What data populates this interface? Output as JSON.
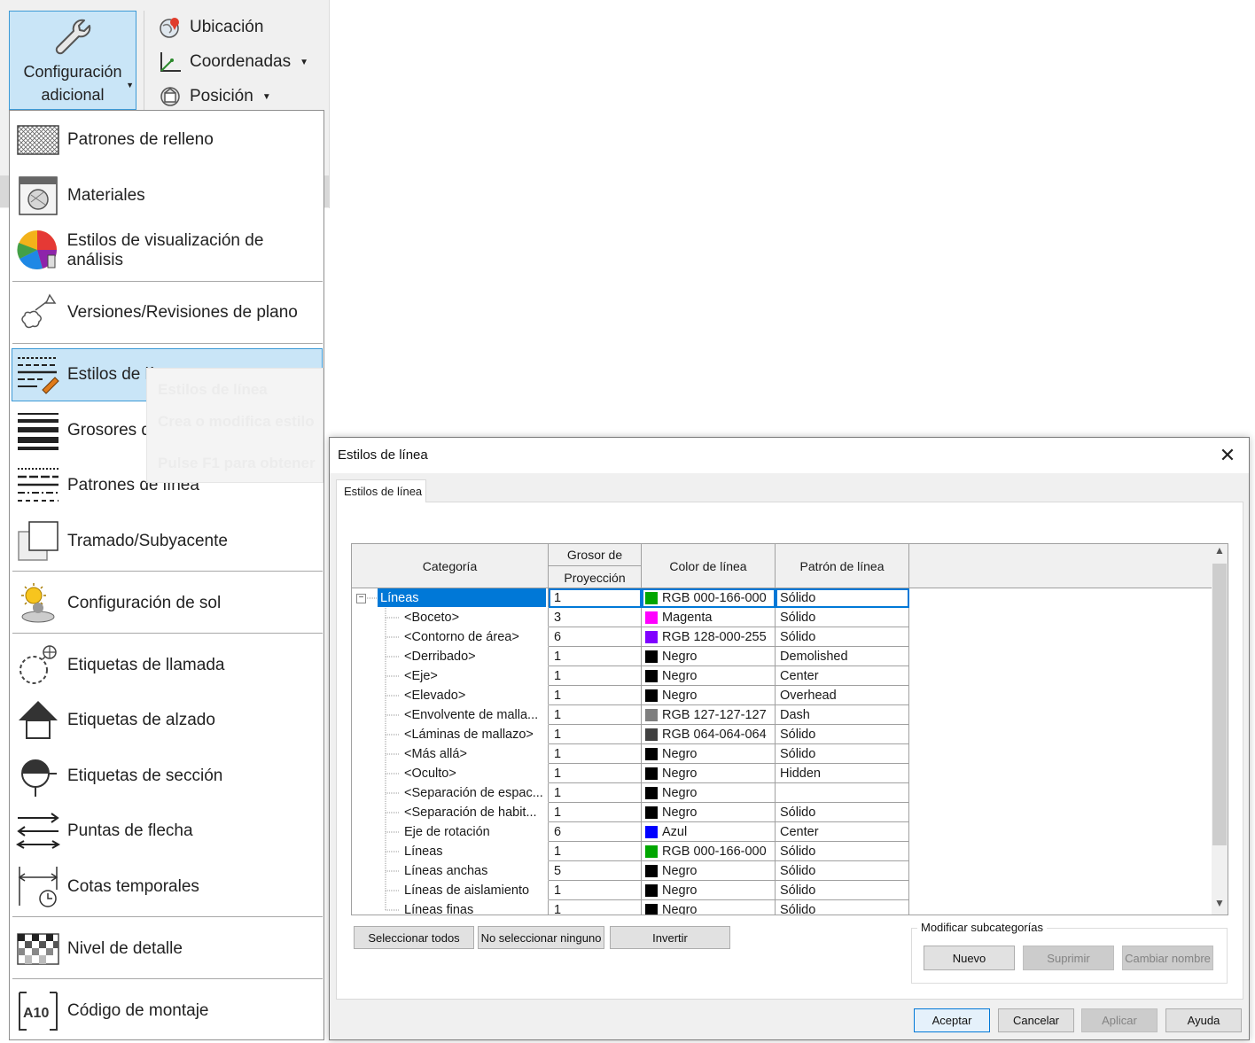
{
  "ribbon": {
    "config_button": {
      "line1": "Configuración",
      "line2": "adicional"
    },
    "items": [
      {
        "label": "Ubicación",
        "icon": "globe-pin-icon",
        "dropdown": false
      },
      {
        "label": "Coordenadas",
        "icon": "axes-icon",
        "dropdown": true
      },
      {
        "label": "Posición",
        "icon": "position-icon",
        "dropdown": true
      }
    ]
  },
  "menu": {
    "items": [
      {
        "label": "Patrones de relleno",
        "icon": "fill-pattern-icon"
      },
      {
        "label": "Materiales",
        "icon": "materials-icon"
      },
      {
        "label": "Estilos de visualización de análisis",
        "icon": "analysis-display-icon"
      },
      {
        "label": "Versiones/Revisiones de plano",
        "icon": "revision-cloud-icon"
      },
      {
        "label": "Estilos de línea",
        "icon": "line-styles-icon",
        "active": true
      },
      {
        "label": "Grosores de línea",
        "icon": "line-weights-icon"
      },
      {
        "label": "Patrones de línea",
        "icon": "line-patterns-icon"
      },
      {
        "label": "Tramado/Subyacente",
        "icon": "halftone-underlay-icon"
      },
      {
        "label": "Configuración de sol",
        "icon": "sun-settings-icon"
      },
      {
        "label": "Etiquetas de llamada",
        "icon": "callout-tags-icon"
      },
      {
        "label": "Etiquetas de alzado",
        "icon": "elevation-tags-icon"
      },
      {
        "label": "Etiquetas de sección",
        "icon": "section-tags-icon"
      },
      {
        "label": "Puntas de flecha",
        "icon": "arrowheads-icon"
      },
      {
        "label": "Cotas temporales",
        "icon": "temporary-dimensions-icon"
      },
      {
        "label": "Nivel de detalle",
        "icon": "detail-level-icon"
      },
      {
        "label": "Código de montaje",
        "icon": "assembly-code-icon"
      }
    ],
    "tooltip": {
      "title": "Estilos de línea",
      "desc": "Crea o modifica estilo",
      "help": "Pulse F1 para obtener"
    }
  },
  "dialog": {
    "title": "Estilos de línea",
    "tab": "Estilos de línea",
    "columns": {
      "category": "Categoría",
      "weight_top": "Grosor de",
      "weight_bottom": "Proyección",
      "color": "Color de línea",
      "pattern": "Patrón de línea"
    },
    "rows": [
      {
        "category": "Líneas",
        "weight": "1",
        "color": "RGB 000-166-000",
        "swatch": "#00a600",
        "pattern": "Sólido",
        "level": 0,
        "selected": true
      },
      {
        "category": "<Boceto>",
        "weight": "3",
        "color": "Magenta",
        "swatch": "#ff00ff",
        "pattern": "Sólido",
        "level": 1
      },
      {
        "category": "<Contorno de área>",
        "weight": "6",
        "color": "RGB 128-000-255",
        "swatch": "#8000ff",
        "pattern": "Sólido",
        "level": 1
      },
      {
        "category": "<Derribado>",
        "weight": "1",
        "color": "Negro",
        "swatch": "#000000",
        "pattern": "Demolished",
        "level": 1
      },
      {
        "category": "<Eje>",
        "weight": "1",
        "color": "Negro",
        "swatch": "#000000",
        "pattern": "Center",
        "level": 1
      },
      {
        "category": "<Elevado>",
        "weight": "1",
        "color": "Negro",
        "swatch": "#000000",
        "pattern": "Overhead",
        "level": 1
      },
      {
        "category": "<Envolvente de malla...",
        "weight": "1",
        "color": "RGB 127-127-127",
        "swatch": "#7f7f7f",
        "pattern": "Dash",
        "level": 1
      },
      {
        "category": "<Láminas de mallazo>",
        "weight": "1",
        "color": "RGB 064-064-064",
        "swatch": "#404040",
        "pattern": "Sólido",
        "level": 1
      },
      {
        "category": "<Más allá>",
        "weight": "1",
        "color": "Negro",
        "swatch": "#000000",
        "pattern": "Sólido",
        "level": 1
      },
      {
        "category": "<Oculto>",
        "weight": "1",
        "color": "Negro",
        "swatch": "#000000",
        "pattern": "Hidden",
        "level": 1
      },
      {
        "category": "<Separación de espac...",
        "weight": "1",
        "color": "Negro",
        "swatch": "#000000",
        "pattern": "",
        "level": 1
      },
      {
        "category": "<Separación de habit...",
        "weight": "1",
        "color": "Negro",
        "swatch": "#000000",
        "pattern": "Sólido",
        "level": 1
      },
      {
        "category": "Eje de rotación",
        "weight": "6",
        "color": "Azul",
        "swatch": "#0000ff",
        "pattern": "Center",
        "level": 1
      },
      {
        "category": "Líneas",
        "weight": "1",
        "color": "RGB 000-166-000",
        "swatch": "#00a600",
        "pattern": "Sólido",
        "level": 1
      },
      {
        "category": "Líneas anchas",
        "weight": "5",
        "color": "Negro",
        "swatch": "#000000",
        "pattern": "Sólido",
        "level": 1
      },
      {
        "category": "Líneas de aislamiento",
        "weight": "1",
        "color": "Negro",
        "swatch": "#000000",
        "pattern": "Sólido",
        "level": 1
      },
      {
        "category": "Líneas finas",
        "weight": "1",
        "color": "Negro",
        "swatch": "#000000",
        "pattern": "Sólido",
        "level": 1
      }
    ],
    "buttons": {
      "select_all": "Seleccionar todos",
      "select_none": "No seleccionar ninguno",
      "invert": "Invertir",
      "subcategories_group": "Modificar subcategorías",
      "new": "Nuevo",
      "delete": "Suprimir",
      "rename": "Cambiar nombre",
      "ok": "Aceptar",
      "cancel": "Cancelar",
      "apply": "Aplicar",
      "help": "Ayuda"
    }
  }
}
